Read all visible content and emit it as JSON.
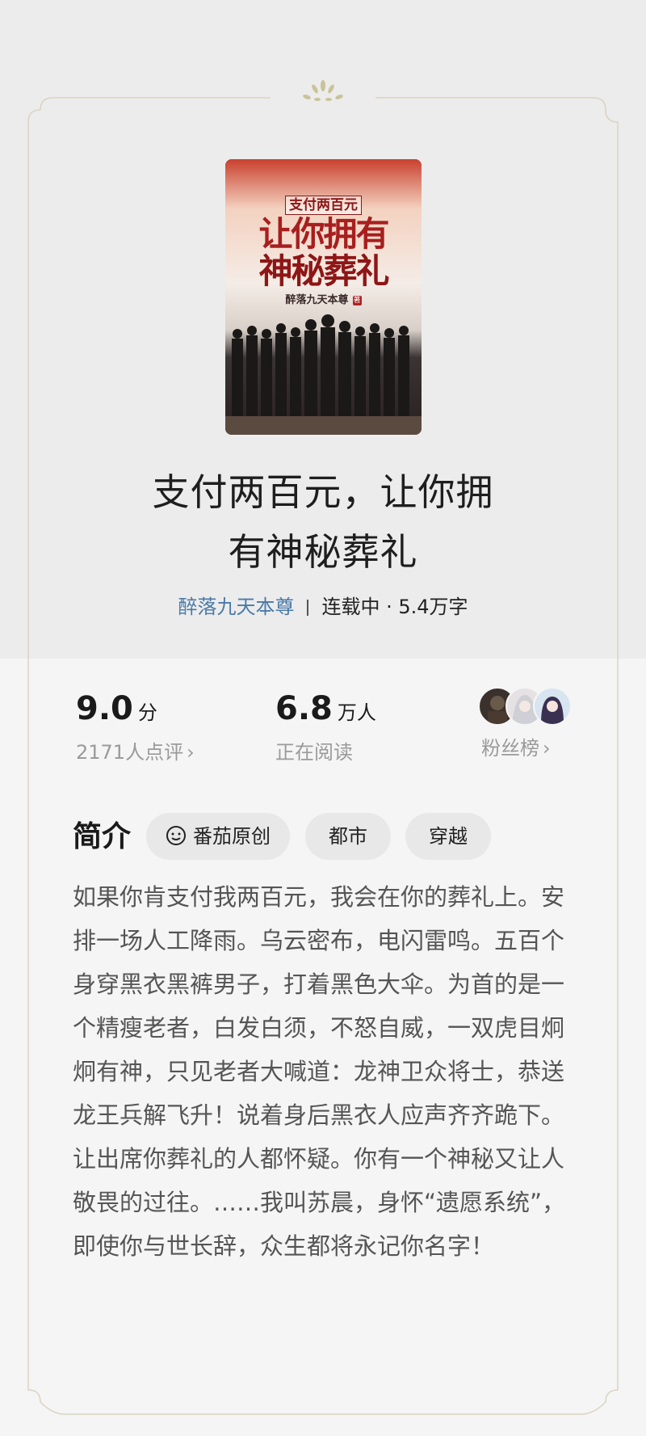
{
  "book": {
    "cover_title_small": "支付两百元",
    "cover_title_line1": "让你拥有",
    "cover_title_line2": "神秘葬礼",
    "cover_author": "醉落九天本尊",
    "cover_badge": "著",
    "title_line1": "支付两百元，让你拥",
    "title_line2": "有神秘葬礼",
    "author": "醉落九天本尊",
    "status": "连载中 · 5.4万字"
  },
  "stats": {
    "rating_value": "9.0",
    "rating_unit": "分",
    "rating_sub": "2171人点评",
    "readers_value": "6.8",
    "readers_unit": "万人",
    "readers_sub": "正在阅读",
    "fans_label": "粉丝榜"
  },
  "intro": {
    "heading": "简介",
    "tags": [
      {
        "label": "番茄原创",
        "icon": "smiley-icon"
      },
      {
        "label": "都市"
      },
      {
        "label": "穿越"
      }
    ],
    "synopsis": "如果你肯支付我两百元，我会在你的葬礼上。安排一场人工降雨。乌云密布，电闪雷鸣。五百个身穿黑衣黑裤男子，打着黑色大伞。为首的是一个精瘦老者，白发白须，不怒自威，一双虎目炯炯有神，只见老者大喊道：龙神卫众将士，恭送龙王兵解飞升！说着身后黑衣人应声齐齐跪下。让出席你葬礼的人都怀疑。你有一个神秘又让人敬畏的过往。……我叫苏晨，身怀“遗愿系统”，即使你与世长辞，众生都将永记你名字！"
  },
  "colors": {
    "author_link": "#4a7aa8",
    "muted_text": "#9a9a9a",
    "frame_line": "#d9d3c2",
    "ornament": "#c9c39a",
    "cover_title_red": "#a81e1e"
  },
  "icons": {
    "chevron": "chevron-right-icon"
  }
}
